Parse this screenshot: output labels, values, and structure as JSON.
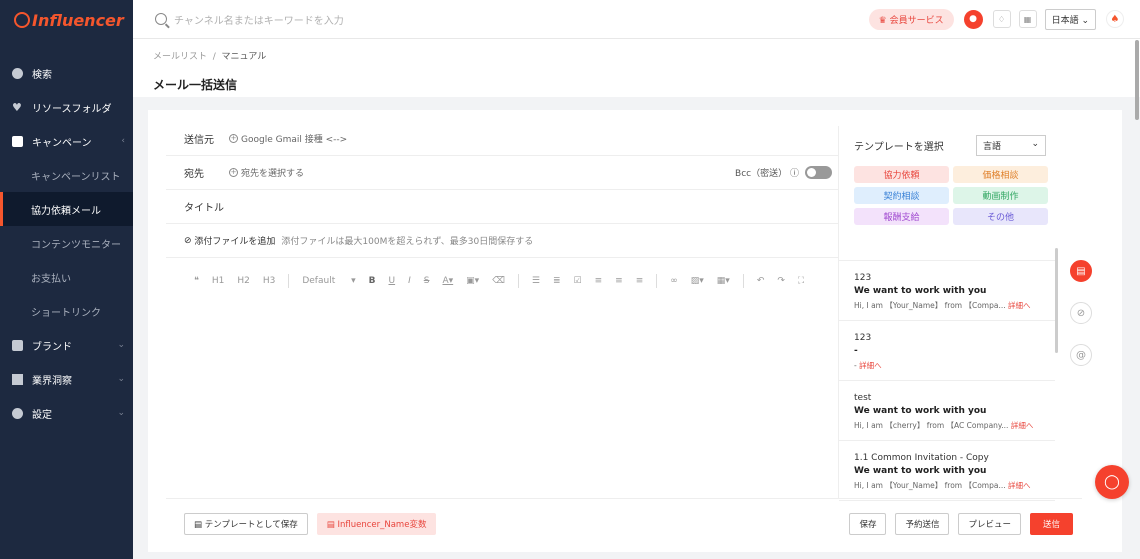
{
  "brand": {
    "logo_text": "Influencer",
    "accent": "#f5412d"
  },
  "sidebar": {
    "items": [
      {
        "label": "検索",
        "icon": "compass-icon"
      },
      {
        "label": "リソースフォルダ",
        "icon": "heart-icon"
      },
      {
        "label": "キャンペーン",
        "icon": "document-icon"
      },
      {
        "label": "キャンペーンリスト"
      },
      {
        "label": "協力依頼メール"
      },
      {
        "label": "コンテンツモニター"
      },
      {
        "label": "お支払い"
      },
      {
        "label": "ショートリンク"
      },
      {
        "label": "ブランド",
        "icon": "brand-icon"
      },
      {
        "label": "業界洞察",
        "icon": "monitor-icon"
      },
      {
        "label": "設定",
        "icon": "gear-icon"
      }
    ]
  },
  "topbar": {
    "search_placeholder": "チャンネル名またはキーワードを入力",
    "member_label": "会員サービス",
    "language": "日本語"
  },
  "header": {
    "breadcrumb_1": "メールリスト",
    "breadcrumb_sep": "/",
    "breadcrumb_2": "マニュアル",
    "title": "メール一括送信"
  },
  "form": {
    "from_label": "送信元",
    "from_value": "Google Gmail 接種 <-->",
    "to_label": "宛先",
    "to_value": "宛先を選択する",
    "bcc_label": "Bcc（密送）",
    "title_label": "タイトル",
    "attach_label": "添付ファイルを追加",
    "attach_hint": "添付ファイルは最大100Mを超えられず、最多30日間保存する",
    "toolbar": {
      "quote": "❝",
      "h1": "H1",
      "h2": "H2",
      "h3": "H3",
      "font": "Default"
    }
  },
  "templates": {
    "heading": "テンプレートを選択",
    "lang_select": "言語",
    "categories": [
      {
        "label": "協力依頼",
        "bg": "#fde3e1",
        "fg": "#e8453c"
      },
      {
        "label": "価格相談",
        "bg": "#fdeedd",
        "fg": "#e0822d"
      },
      {
        "label": "契約相談",
        "bg": "#dfeefd",
        "fg": "#3b82d6"
      },
      {
        "label": "動画制作",
        "bg": "#ddf5e8",
        "fg": "#34a864"
      },
      {
        "label": "報酬支給",
        "bg": "#f3e2fb",
        "fg": "#a24dd1"
      },
      {
        "label": "その他",
        "bg": "#e8e6fb",
        "fg": "#6a5bd6"
      }
    ],
    "items": [
      {
        "name": "123",
        "subject": "We want to work with you",
        "desc": "Hi, I am 【Your_Name】 from 【Compa...",
        "more": "詳細へ"
      },
      {
        "name": "123",
        "subject": "-",
        "desc": "-",
        "more": "詳細へ"
      },
      {
        "name": "test",
        "subject": "We want to work with you",
        "desc": "Hi, I am 【cherry】 from 【AC Company...",
        "more": "詳細へ"
      },
      {
        "name": "1.1 Common Invitation - Copy",
        "subject": "We want to work with you",
        "desc": "Hi, I am 【Your_Name】 from 【Compa...",
        "more": "詳細へ"
      }
    ]
  },
  "footer": {
    "save_template": "テンプレートとして保存",
    "variable": "Influencer_Name変数",
    "save": "保存",
    "schedule": "予約送信",
    "preview": "プレビュー",
    "send": "送信"
  }
}
